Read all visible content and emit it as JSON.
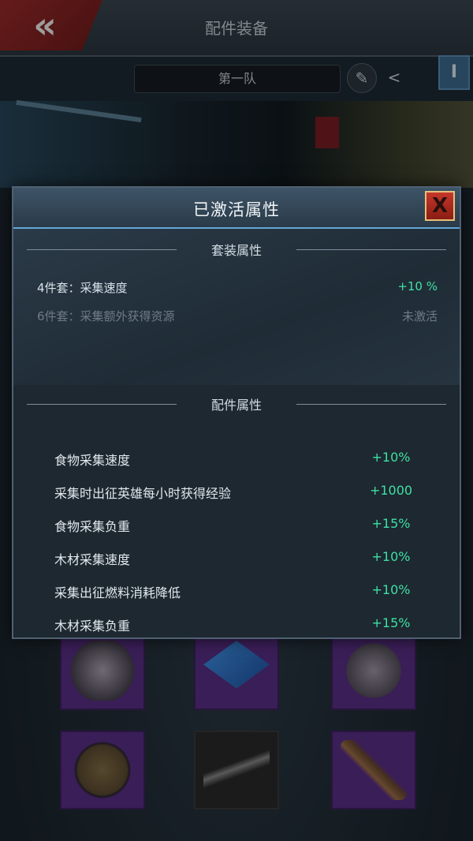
{
  "topbar": {
    "title": "配件装备",
    "back_glyph": "«",
    "team_name": "第一队",
    "edit_icon": "pencil-icon",
    "share_icon": "share-icon",
    "info_label": "I"
  },
  "modal": {
    "title": "已激活属性",
    "close_label": "X",
    "set_section": {
      "heading": "套装属性",
      "rows": [
        {
          "name": "4件套：采集速度",
          "value": "+10 %",
          "active": true
        },
        {
          "name": "6件套：采集额外获得资源",
          "value": "未激活",
          "active": false
        }
      ]
    },
    "parts_section": {
      "heading": "配件属性",
      "rows": [
        {
          "name": "食物采集速度",
          "value": "+10%"
        },
        {
          "name": "采集时出征英雄每小时获得经验",
          "value": "+1000"
        },
        {
          "name": "食物采集负重",
          "value": "+15%"
        },
        {
          "name": "木材采集速度",
          "value": "+10%"
        },
        {
          "name": "采集出征燃料消耗降低",
          "value": "+10%"
        },
        {
          "name": "木材采集负重",
          "value": "+15%"
        }
      ]
    }
  },
  "colors": {
    "accent_green": "#3fe0a4",
    "slot_purple": "#5a2f86",
    "close_red": "#c5372b"
  }
}
